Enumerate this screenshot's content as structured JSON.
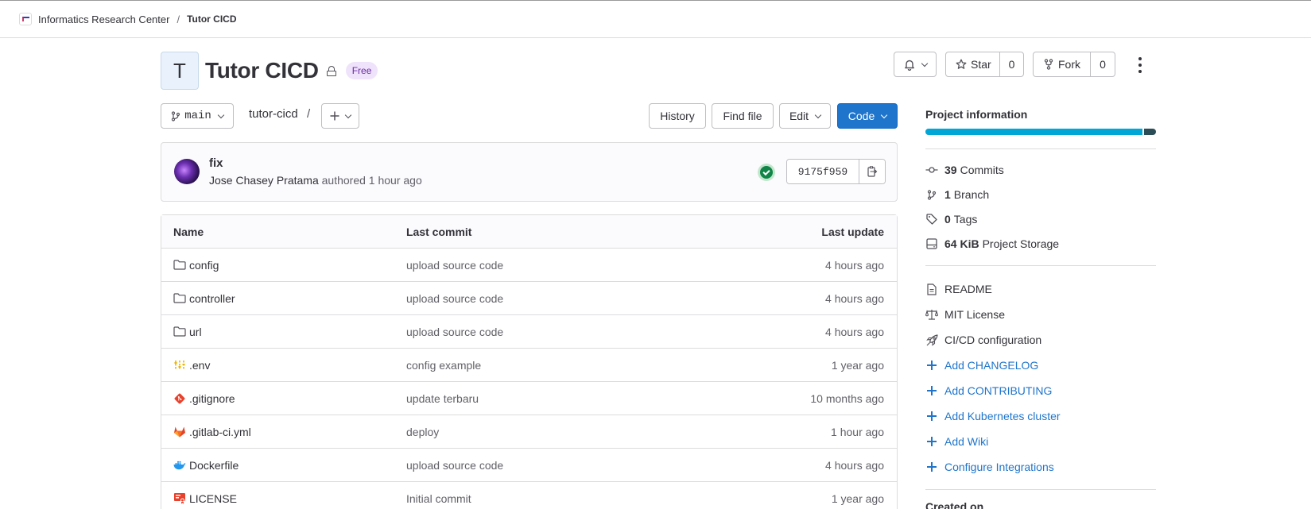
{
  "breadcrumb": {
    "group": "Informatics Research Center",
    "separator": "/",
    "project": "Tutor CICD"
  },
  "project": {
    "avatar_letter": "T",
    "title": "Tutor CICD",
    "tier_badge": "Free"
  },
  "actions": {
    "star_label": "Star",
    "star_count": "0",
    "fork_label": "Fork",
    "fork_count": "0"
  },
  "repo_toolbar": {
    "branch": "main",
    "path": "tutor-cicd",
    "path_separator": "/",
    "history_label": "History",
    "find_file_label": "Find file",
    "edit_label": "Edit",
    "code_label": "Code"
  },
  "last_commit": {
    "title": "fix",
    "author": "Jose Chasey Pratama",
    "meta": "authored 1 hour ago",
    "sha": "9175f959",
    "pipeline_status": "passed"
  },
  "file_table": {
    "headers": {
      "name": "Name",
      "last_commit": "Last commit",
      "last_update": "Last update"
    },
    "rows": [
      {
        "name": "config",
        "icon": "folder-icon",
        "commit": "upload source code",
        "updated": "4 hours ago"
      },
      {
        "name": "controller",
        "icon": "folder-icon",
        "commit": "upload source code",
        "updated": "4 hours ago"
      },
      {
        "name": "url",
        "icon": "folder-icon",
        "commit": "upload source code",
        "updated": "4 hours ago"
      },
      {
        "name": ".env",
        "icon": "env-file-icon",
        "commit": "config example",
        "updated": "1 year ago"
      },
      {
        "name": ".gitignore",
        "icon": "git-icon",
        "commit": "update terbaru",
        "updated": "10 months ago"
      },
      {
        "name": ".gitlab-ci.yml",
        "icon": "gitlab-icon",
        "commit": "deploy",
        "updated": "1 hour ago"
      },
      {
        "name": "Dockerfile",
        "icon": "docker-icon",
        "commit": "upload source code",
        "updated": "4 hours ago"
      },
      {
        "name": "LICENSE",
        "icon": "license-icon",
        "commit": "Initial commit",
        "updated": "1 year ago"
      }
    ]
  },
  "sidebar": {
    "title": "Project information",
    "language_bar": [
      {
        "fraction": 0.94,
        "color": "#00a6d6"
      },
      {
        "fraction": 0.06,
        "color": "#2b4d57"
      }
    ],
    "stats": [
      {
        "count": "39",
        "label": "Commits",
        "icon": "commit-icon"
      },
      {
        "count": "1",
        "label": "Branch",
        "icon": "branch-icon"
      },
      {
        "count": "0",
        "label": "Tags",
        "icon": "tag-icon"
      },
      {
        "count": "64 KiB",
        "label": "Project Storage",
        "icon": "storage-icon"
      }
    ],
    "files": [
      {
        "label": "README",
        "icon": "file-icon"
      },
      {
        "label": "MIT License",
        "icon": "scale-icon"
      },
      {
        "label": "CI/CD configuration",
        "icon": "rocket-icon"
      }
    ],
    "add_links": [
      "Add CHANGELOG",
      "Add CONTRIBUTING",
      "Add Kubernetes cluster",
      "Add Wiki",
      "Configure Integrations"
    ],
    "created_on_label": "Created on"
  },
  "colors": {
    "primary": "#1f75cb",
    "success": "#108548",
    "badge_bg": "#efe3fb"
  }
}
